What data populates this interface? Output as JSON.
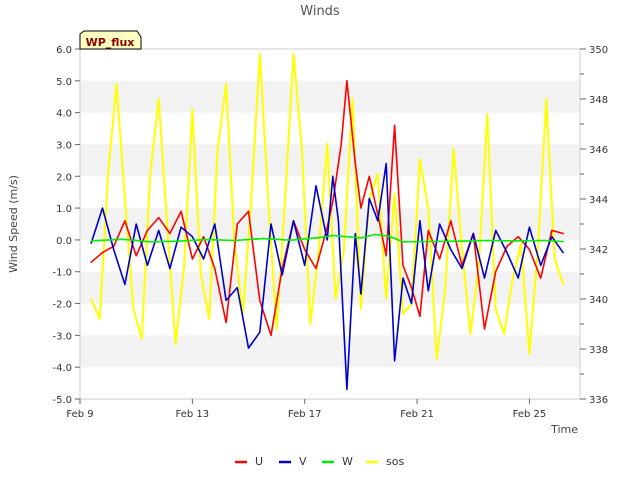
{
  "chart_data": {
    "type": "line",
    "title": "Winds",
    "xlabel": "Time",
    "ylabel": "Wind Speed (m/s)",
    "badge": "WP_flux",
    "x_ticks": [
      "Feb 9",
      "Feb 13",
      "Feb 17",
      "Feb 21",
      "Feb 25"
    ],
    "x_range_days": [
      9,
      26.8
    ],
    "ylim": [
      -5.0,
      6.0
    ],
    "y_ticks": [
      "-5.0",
      "-4.0",
      "-3.0",
      "-2.0",
      "-1.0",
      "0.0",
      "1.0",
      "2.0",
      "3.0",
      "4.0",
      "5.0",
      "6.0"
    ],
    "y2lim": [
      336,
      350
    ],
    "y2_ticks": [
      "336",
      "338",
      "340",
      "342",
      "344",
      "346",
      "348",
      "350"
    ],
    "grid": "horizontal bands",
    "legend_position": "bottom",
    "series": [
      {
        "name": "U",
        "color": "#ff0000",
        "axis": "left",
        "x": [
          9.4,
          9.8,
          10.2,
          10.6,
          11.0,
          11.4,
          11.8,
          12.2,
          12.6,
          13.0,
          13.4,
          13.8,
          14.2,
          14.6,
          15.0,
          15.4,
          15.8,
          16.2,
          16.6,
          17.0,
          17.4,
          17.8,
          18.0,
          18.3,
          18.5,
          18.8,
          19.0,
          19.3,
          19.6,
          19.9,
          20.2,
          20.5,
          20.8,
          21.1,
          21.4,
          21.8,
          22.2,
          22.6,
          23.0,
          23.4,
          23.8,
          24.2,
          24.6,
          25.0,
          25.4,
          25.8,
          26.2
        ],
        "y": [
          -0.7,
          -0.4,
          -0.2,
          0.6,
          -0.5,
          0.3,
          0.7,
          0.2,
          0.9,
          -0.6,
          0.1,
          -0.9,
          -2.6,
          0.5,
          0.9,
          -1.9,
          -3.0,
          -0.9,
          0.6,
          -0.3,
          -0.9,
          0.4,
          1.2,
          3.0,
          5.0,
          2.4,
          1.0,
          2.0,
          0.8,
          -0.5,
          3.6,
          -0.8,
          -1.5,
          -2.4,
          0.3,
          -0.6,
          0.6,
          -0.8,
          0.2,
          -2.8,
          -1.0,
          -0.2,
          0.1,
          -0.3,
          -1.2,
          0.3,
          0.2
        ]
      },
      {
        "name": "V",
        "color": "#0000cc",
        "axis": "left",
        "x": [
          9.4,
          9.8,
          10.2,
          10.6,
          11.0,
          11.4,
          11.8,
          12.2,
          12.6,
          13.0,
          13.4,
          13.8,
          14.2,
          14.6,
          15.0,
          15.4,
          15.8,
          16.2,
          16.6,
          17.0,
          17.4,
          17.8,
          18.0,
          18.2,
          18.5,
          18.8,
          19.0,
          19.3,
          19.6,
          19.9,
          20.2,
          20.5,
          20.8,
          21.1,
          21.4,
          21.8,
          22.2,
          22.6,
          23.0,
          23.4,
          23.8,
          24.2,
          24.6,
          25.0,
          25.4,
          25.8,
          26.2
        ],
        "y": [
          -0.1,
          1.0,
          -0.3,
          -1.4,
          0.5,
          -0.8,
          0.3,
          -0.9,
          0.4,
          0.1,
          -0.6,
          0.5,
          -1.9,
          -1.5,
          -3.4,
          -2.9,
          0.5,
          -1.1,
          0.6,
          -0.8,
          1.7,
          0.0,
          2.0,
          0.6,
          -4.7,
          0.2,
          -1.7,
          1.3,
          0.6,
          2.4,
          -3.8,
          -1.2,
          -2.0,
          0.6,
          -1.6,
          0.5,
          -0.3,
          -0.9,
          0.2,
          -1.2,
          0.3,
          -0.4,
          -1.2,
          0.4,
          -0.8,
          0.1,
          -0.4
        ]
      },
      {
        "name": "W",
        "color": "#00ee00",
        "axis": "left",
        "x": [
          9.4,
          10.5,
          11.5,
          12.5,
          13.5,
          14.5,
          15.5,
          16.5,
          17.5,
          18.0,
          18.5,
          19.0,
          19.5,
          20.0,
          20.5,
          21.5,
          22.5,
          23.5,
          24.5,
          25.5,
          26.2
        ],
        "y": [
          -0.03,
          0.02,
          -0.06,
          -0.04,
          0.01,
          -0.02,
          0.04,
          -0.01,
          0.07,
          0.14,
          0.1,
          0.06,
          0.17,
          0.12,
          -0.06,
          -0.05,
          -0.04,
          -0.02,
          -0.03,
          -0.02,
          -0.05
        ]
      },
      {
        "name": "sos",
        "color": "#ffff00",
        "axis": "right",
        "x": [
          9.4,
          9.7,
          10.0,
          10.3,
          10.6,
          10.9,
          11.2,
          11.5,
          11.8,
          12.1,
          12.4,
          12.7,
          13.0,
          13.3,
          13.6,
          13.9,
          14.2,
          14.5,
          14.8,
          15.1,
          15.4,
          15.7,
          16.0,
          16.3,
          16.6,
          16.9,
          17.2,
          17.5,
          17.8,
          18.1,
          18.4,
          18.7,
          19.0,
          19.3,
          19.6,
          19.9,
          20.2,
          20.5,
          20.8,
          21.1,
          21.4,
          21.7,
          22.0,
          22.3,
          22.6,
          22.9,
          23.2,
          23.5,
          23.8,
          24.1,
          24.4,
          24.7,
          25.0,
          25.3,
          25.6,
          25.9,
          26.2
        ],
        "y": [
          340.0,
          339.2,
          345.0,
          348.6,
          344.0,
          339.6,
          338.4,
          345.0,
          348.0,
          343.0,
          338.2,
          341.2,
          347.6,
          341.0,
          339.2,
          346.0,
          348.6,
          342.2,
          339.4,
          344.0,
          349.8,
          344.0,
          338.8,
          344.0,
          349.8,
          346.0,
          339.0,
          342.0,
          346.2,
          340.0,
          342.0,
          348.0,
          339.6,
          344.0,
          345.0,
          340.0,
          344.2,
          339.4,
          339.8,
          345.6,
          343.6,
          337.6,
          340.4,
          346.0,
          342.0,
          338.6,
          341.4,
          347.4,
          339.6,
          338.6,
          340.8,
          342.2,
          337.8,
          342.0,
          348.0,
          341.6,
          340.6
        ]
      }
    ]
  }
}
